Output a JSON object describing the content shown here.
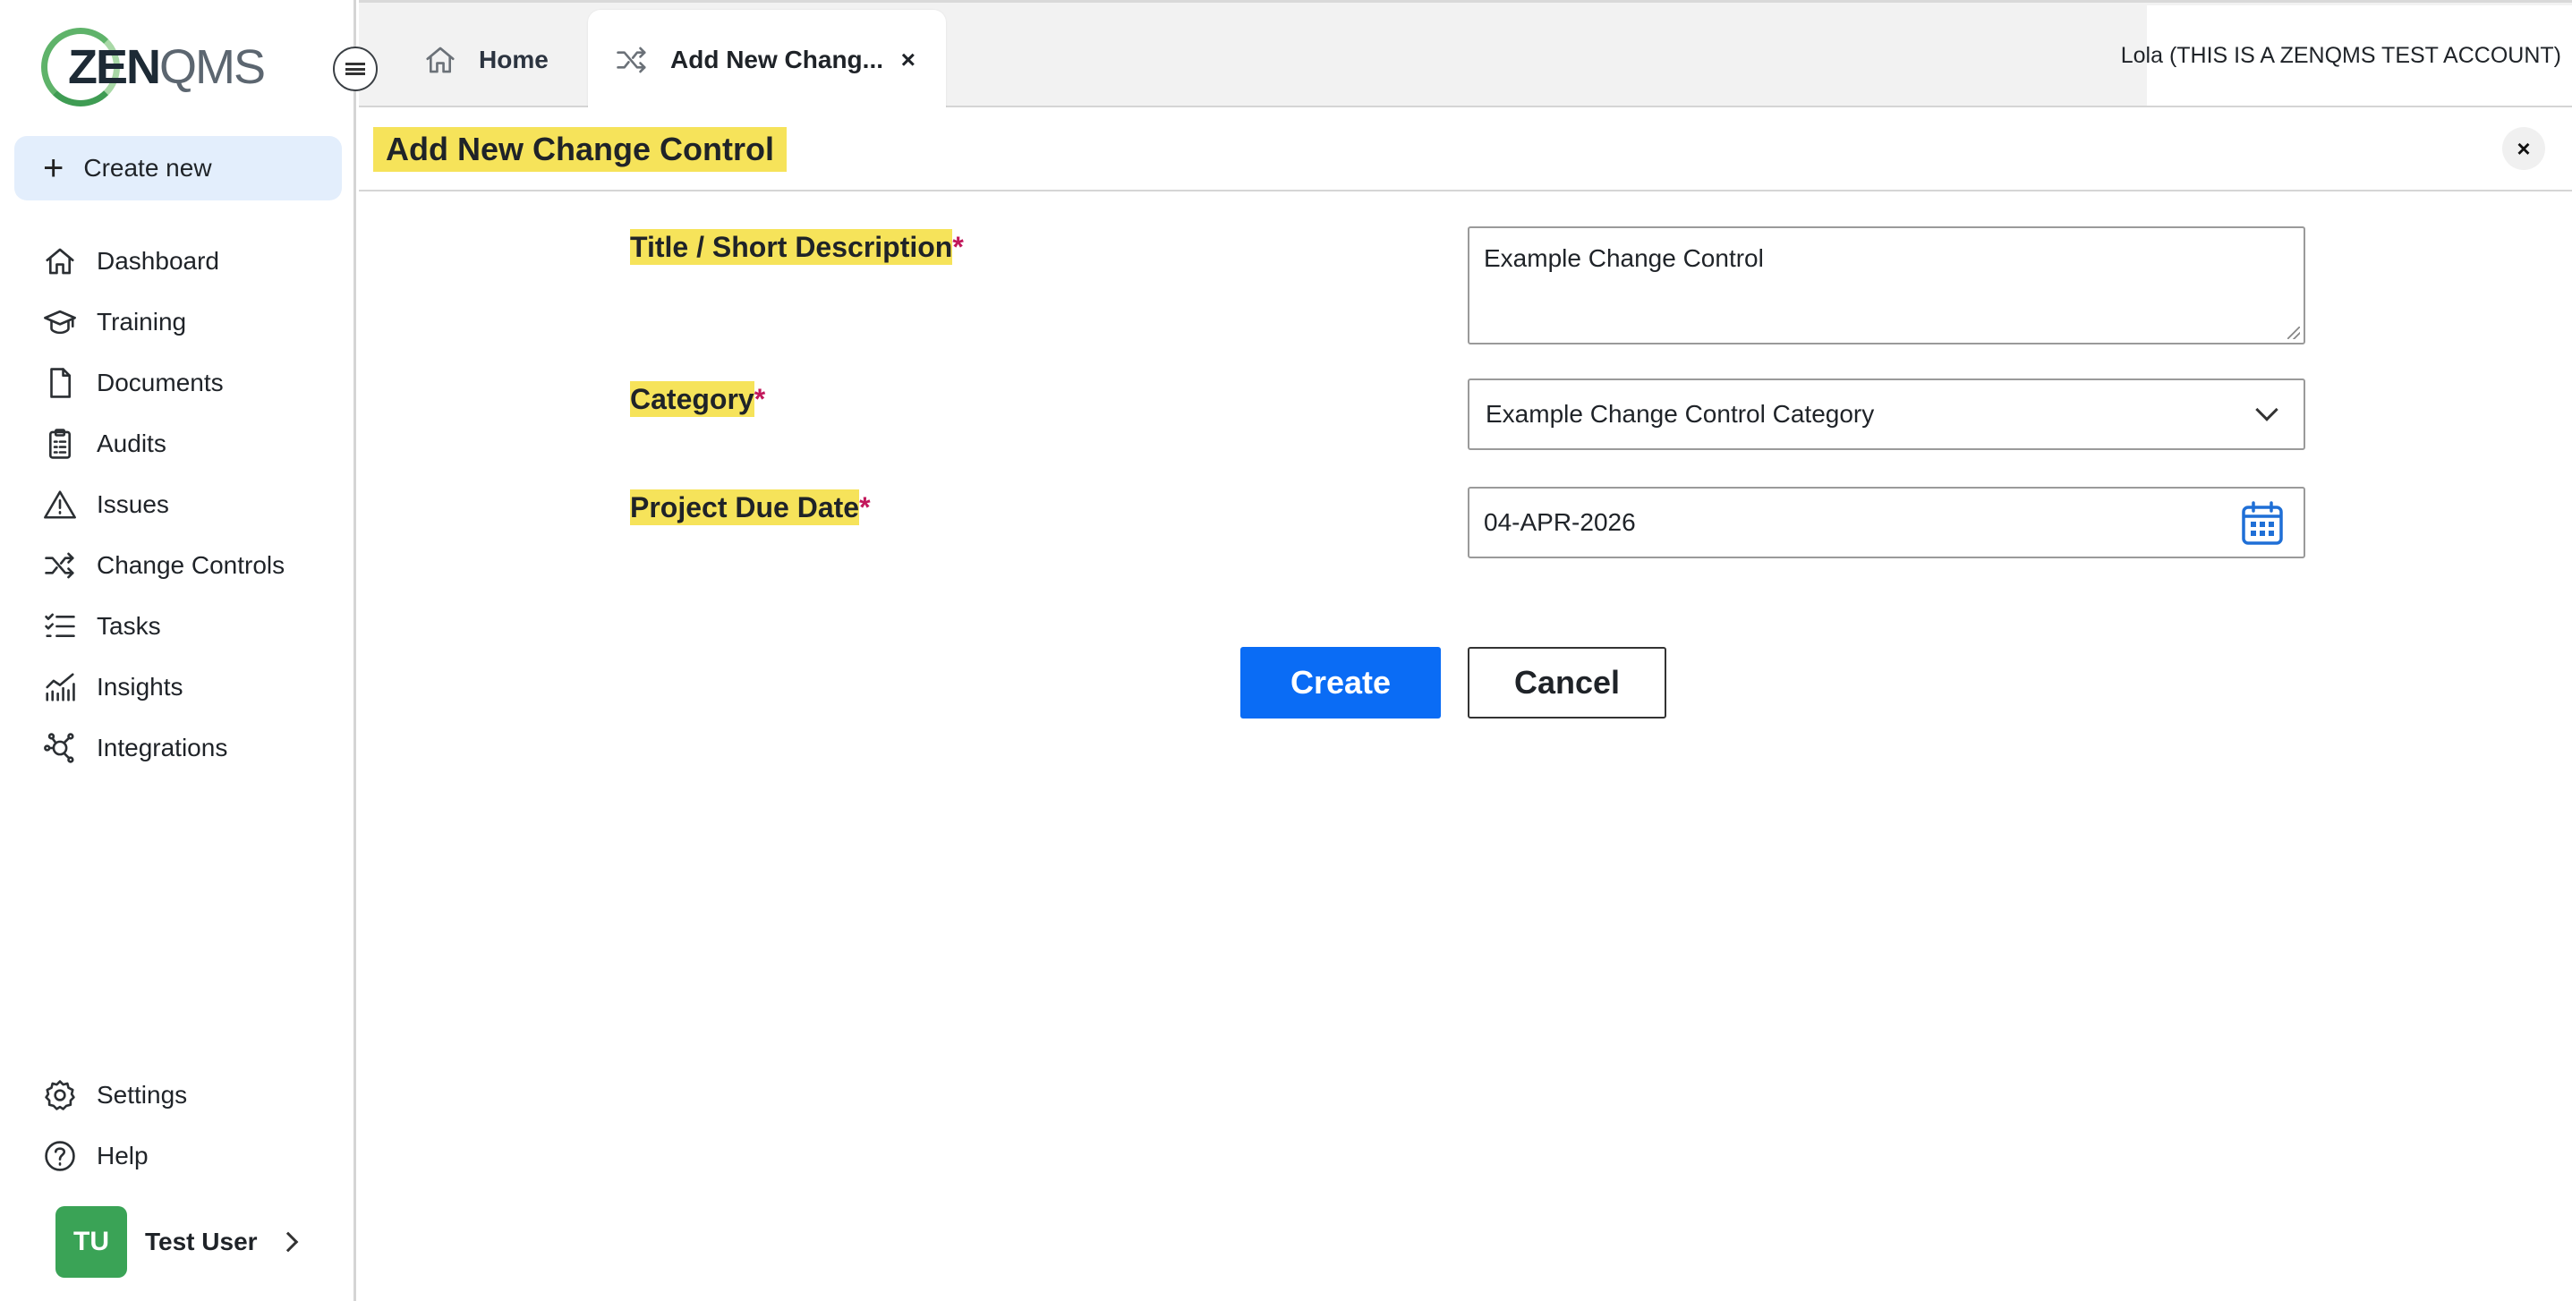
{
  "brand": {
    "logo_prefix": "ZEN",
    "logo_suffix": "QMS"
  },
  "sidebar": {
    "create_new_label": "Create new",
    "items": [
      {
        "label": "Dashboard",
        "icon": "home-icon"
      },
      {
        "label": "Training",
        "icon": "graduation-cap-icon"
      },
      {
        "label": "Documents",
        "icon": "document-icon"
      },
      {
        "label": "Audits",
        "icon": "clipboard-icon"
      },
      {
        "label": "Issues",
        "icon": "warning-icon"
      },
      {
        "label": "Change Controls",
        "icon": "shuffle-icon"
      },
      {
        "label": "Tasks",
        "icon": "checklist-icon"
      },
      {
        "label": "Insights",
        "icon": "chart-icon"
      },
      {
        "label": "Integrations",
        "icon": "network-icon"
      }
    ],
    "bottom_items": [
      {
        "label": "Settings",
        "icon": "gear-icon"
      },
      {
        "label": "Help",
        "icon": "help-icon"
      }
    ],
    "user": {
      "initials": "TU",
      "name": "Test User"
    }
  },
  "tabs": [
    {
      "label": "Home",
      "icon": "home-icon",
      "active": false
    },
    {
      "label": "Add New Chang...",
      "icon": "shuffle-icon",
      "active": true,
      "close": "×"
    }
  ],
  "account_label": "Lola (THIS IS A ZENQMS TEST ACCOUNT)",
  "page": {
    "title": "Add New Change Control",
    "close": "×"
  },
  "form": {
    "title_label": "Title / Short Description",
    "title_value": "Example Change Control",
    "category_label": "Category",
    "category_value": "Example Change Control Category",
    "due_date_label": "Project Due Date",
    "due_date_value": "04-APR-2026",
    "required_mark": "*",
    "create_label": "Create",
    "cancel_label": "Cancel"
  },
  "colors": {
    "primary": "#0a6cf5",
    "highlight": "#f6e35a",
    "required": "#c2185b",
    "create_new_bg": "#e3eefc",
    "avatar_bg": "#3aa356"
  }
}
